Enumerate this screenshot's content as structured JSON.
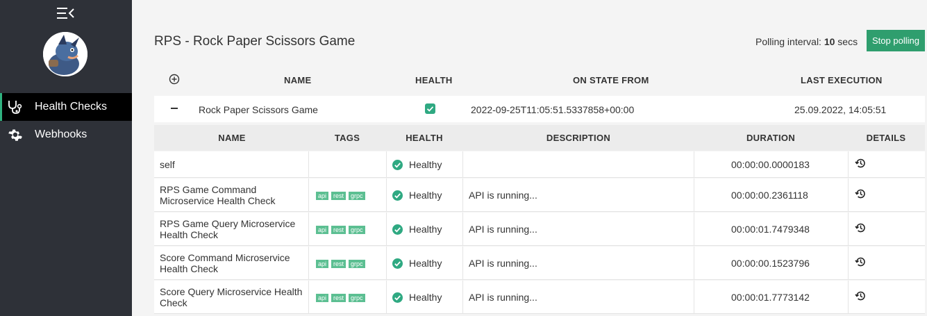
{
  "page": {
    "title": "RPS - Rock Paper Scissors Game",
    "polling_prefix": "Polling interval:",
    "polling_value": "10",
    "polling_unit": "secs",
    "stop_button": "Stop polling"
  },
  "sidebar": {
    "items": [
      {
        "label": "Health Checks",
        "icon": "stethoscope-icon",
        "active": true
      },
      {
        "label": "Webhooks",
        "icon": "gear-icon",
        "active": false
      }
    ]
  },
  "top_table": {
    "headers": [
      "NAME",
      "HEALTH",
      "ON STATE FROM",
      "LAST EXECUTION"
    ],
    "row": {
      "name": "Rock Paper Scissors Game",
      "on_state_from": "2022-09-25T11:05:51.5337858+00:00",
      "last_execution": "25.09.2022, 14:05:51"
    }
  },
  "detail_table": {
    "headers": [
      "NAME",
      "TAGS",
      "HEALTH",
      "DESCRIPTION",
      "DURATION",
      "DETAILS"
    ],
    "rows": [
      {
        "name": "self",
        "tags": [],
        "health": "Healthy",
        "description": "",
        "duration": "00:00:00.0000183"
      },
      {
        "name": "RPS Game Command Microservice Health Check",
        "tags": [
          "api",
          "rest",
          "grpc"
        ],
        "health": "Healthy",
        "description": "API is running...",
        "duration": "00:00:00.2361118"
      },
      {
        "name": "RPS Game Query Microservice Health Check",
        "tags": [
          "api",
          "rest",
          "grpc"
        ],
        "health": "Healthy",
        "description": "API is running...",
        "duration": "00:00:01.7479348"
      },
      {
        "name": "Score Command Microservice Health Check",
        "tags": [
          "api",
          "rest",
          "grpc"
        ],
        "health": "Healthy",
        "description": "API is running...",
        "duration": "00:00:00.1523796"
      },
      {
        "name": "Score Query Microservice Health Check",
        "tags": [
          "api",
          "rest",
          "grpc"
        ],
        "health": "Healthy",
        "description": "API is running...",
        "duration": "00:00:01.7773142"
      }
    ]
  },
  "colors": {
    "sidebar_bg": "#2e3138",
    "accent": "#2f9e6e",
    "healthy": "#2fa982",
    "tag_bg": "#5cbf92"
  }
}
